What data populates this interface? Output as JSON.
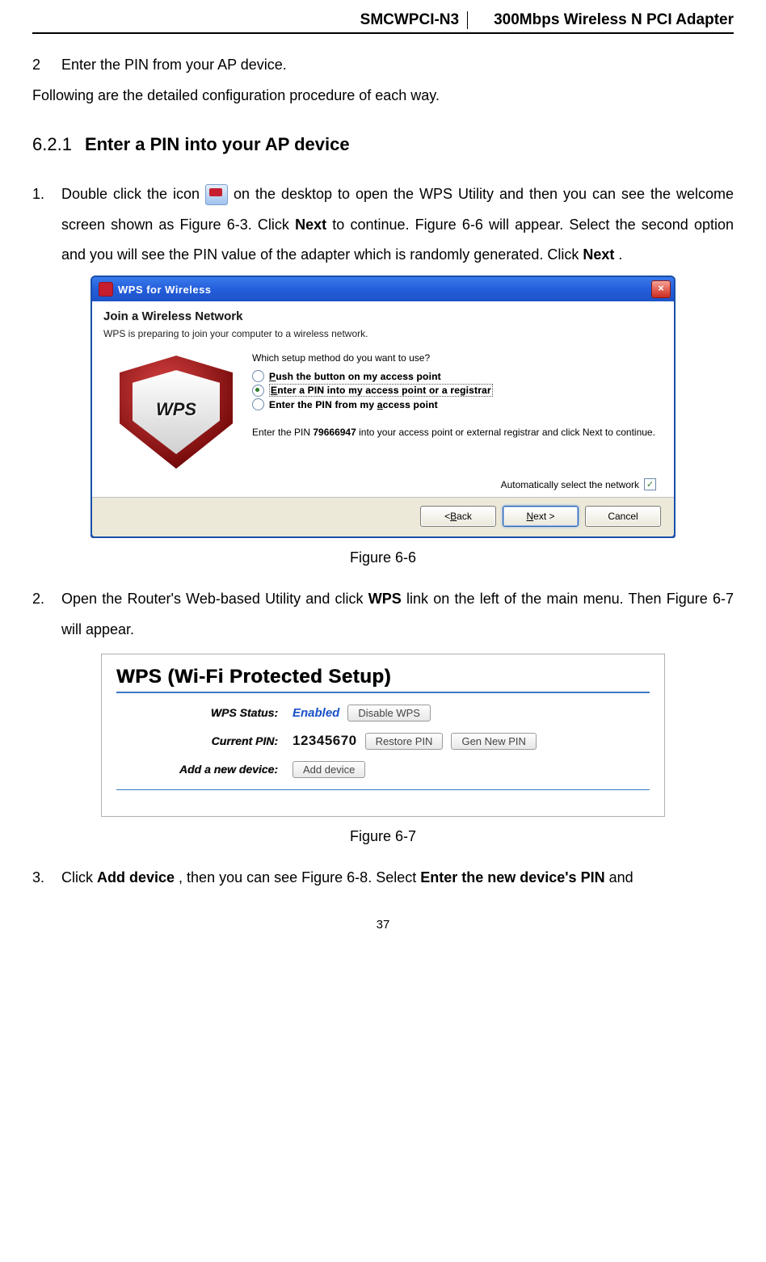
{
  "header": {
    "model": "SMCWPCI-N3",
    "product": "300Mbps Wireless N PCI Adapter"
  },
  "intro": {
    "item2_num": "2",
    "item2_text": "Enter the PIN from your AP device.",
    "following": "Following are the detailed configuration procedure of each way."
  },
  "section": {
    "num": "6.2.1",
    "title": "Enter a PIN into your AP device"
  },
  "step1": {
    "num": "1.",
    "p1a": "Double click the icon ",
    "p1b": " on the desktop to open the WPS Utility and then you can see the welcome screen shown as Figure 6-3. Click ",
    "next1": "Next",
    "p1c": " to continue. Figure 6-6 will appear. Select the second option and you will see the PIN value of the adapter which is randomly generated. Click ",
    "next2": "Next",
    "p1d": "."
  },
  "dialog": {
    "title": "WPS for Wireless",
    "h1": "Join a Wireless Network",
    "sub": "WPS is preparing to join your computer to a wireless network.",
    "question": "Which setup method do you want to use?",
    "opt1_pre": "P",
    "opt1_rest": "ush the button on my access point",
    "opt2_pre": "E",
    "opt2_rest": "nter a PIN into my access point or a registrar",
    "opt3a": "Enter the PIN from my ",
    "opt3_u": "a",
    "opt3b": "ccess point",
    "note_a": "Enter the PIN ",
    "note_pin": "79666947",
    "note_b": " into your access point or external registrar and click Next to continue.",
    "auto": "Automatically select the network",
    "back_u": "B",
    "back": "ack",
    "back_pre": "< ",
    "next_u": "N",
    "next": "ext >",
    "cancel": "Cancel",
    "shield": "WPS"
  },
  "fig66": "Figure 6-6",
  "step2": {
    "num": "2.",
    "a": "Open the Router's Web-based Utility and click ",
    "wps": "WPS",
    "b": " link on the left of the main menu. Then Figure 6-7 will appear."
  },
  "router": {
    "title": "WPS (Wi-Fi Protected Setup)",
    "status_lbl": "WPS Status:",
    "status_val": "Enabled",
    "disable_btn": "Disable WPS",
    "pin_lbl": "Current PIN:",
    "pin_val": "12345670",
    "restore_btn": "Restore PIN",
    "gen_btn": "Gen New PIN",
    "add_lbl": "Add a new device:",
    "add_btn": "Add device"
  },
  "fig67": "Figure 6-7",
  "step3": {
    "num": "3.",
    "a": "Click ",
    "add": "Add device",
    "b": ", then you can see Figure 6-8. Select ",
    "enter": "Enter the new device's PIN",
    "c": " and"
  },
  "page_num": "37"
}
